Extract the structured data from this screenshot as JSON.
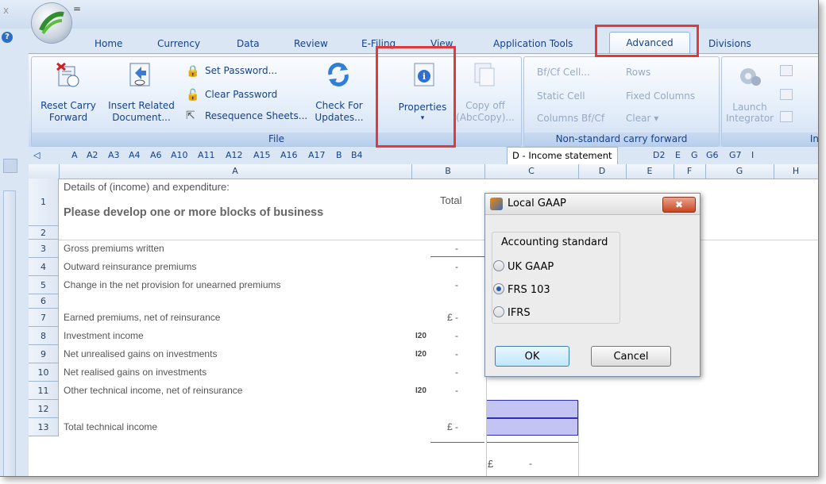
{
  "title_bar": {
    "close_glyph": "x",
    "quick_access": "="
  },
  "ribbon_tabs": [
    "Home",
    "Currency",
    "Data",
    "Review",
    "E-Filing",
    "View",
    "Application Tools",
    "Advanced",
    "Divisions"
  ],
  "ribbon": {
    "file_group": {
      "label": "File",
      "reset_carry_forward": "Reset Carry\nForward",
      "insert_related": "Insert Related\nDocument...",
      "set_password": "Set Password...",
      "clear_password": "Clear Password",
      "resequence_sheets": "Resequence Sheets...",
      "check_updates": "Check For\nUpdates...",
      "properties": "Properties",
      "properties_arrow": "▾",
      "copy_off": "Copy off\n(AbcCopy)..."
    },
    "nonstd_group": {
      "label": "Non-standard carry forward",
      "bfcf_cell": "Bf/Cf Cell...",
      "rows": "Rows",
      "static_cell": "Static Cell",
      "fixed_columns": "Fixed Columns",
      "columns_bfcf": "Columns Bf/Cf",
      "clear": "Clear ▾"
    },
    "integrator_group": {
      "launch": "Launch\nIntegrator",
      "label_partial": "In"
    }
  },
  "sheet_tabs": [
    "A",
    "A2",
    "A3",
    "A4",
    "A6",
    "A10",
    "A11",
    "A12",
    "A15",
    "A16",
    "A17",
    "B",
    "B4"
  ],
  "active_sheet": "D - Income statement",
  "sheet_tabs_after": [
    "D2",
    "E",
    "G",
    "G6",
    "G7",
    "I"
  ],
  "columns": [
    "A",
    "B",
    "C",
    "D",
    "E",
    "F",
    "G",
    "H"
  ],
  "rows": {
    "r1": {
      "num": "1",
      "text": "Details of (income) and expenditure:"
    },
    "r1b": "Please develop one or more blocks of business",
    "total_label": "Total",
    "r2": "2",
    "items": [
      {
        "num": "3",
        "label": "Gross premiums written",
        "code": "",
        "cur": "",
        "val": "-"
      },
      {
        "num": "4",
        "label": "Outward reinsurance premiums",
        "code": "",
        "cur": "",
        "val": "-"
      },
      {
        "num": "5",
        "label": "Change in the net provision for unearned premiums",
        "code": "",
        "cur": "",
        "val": "-"
      },
      {
        "num": "6",
        "label": "",
        "code": "",
        "cur": "",
        "val": ""
      },
      {
        "num": "7",
        "label": "Earned premiums, net of reinsurance",
        "code": "",
        "cur": "£",
        "val": "-"
      },
      {
        "num": "8",
        "label": "Investment income",
        "code": "I20",
        "cur": "",
        "val": "-"
      },
      {
        "num": "9",
        "label": "Net unrealised gains on investments",
        "code": "I20",
        "cur": "",
        "val": "-"
      },
      {
        "num": "10",
        "label": "Net realised gains on investments",
        "code": "",
        "cur": "",
        "val": "-"
      },
      {
        "num": "11",
        "label": "Other technical income, net of reinsurance",
        "code": "I20",
        "cur": "",
        "val": "-"
      },
      {
        "num": "12",
        "label": "",
        "code": "",
        "cur": "",
        "val": ""
      },
      {
        "num": "13",
        "label": "Total technical income",
        "code": "",
        "cur": "£",
        "val": "-"
      }
    ],
    "r13_c_cur": "£",
    "r13_c_val": "-"
  },
  "dialog": {
    "title": "Local GAAP",
    "close": "✖",
    "legend": "Accounting standard",
    "options": [
      "UK GAAP",
      "FRS 103",
      "IFRS"
    ],
    "selected": "FRS 103",
    "ok": "OK",
    "cancel": "Cancel"
  }
}
